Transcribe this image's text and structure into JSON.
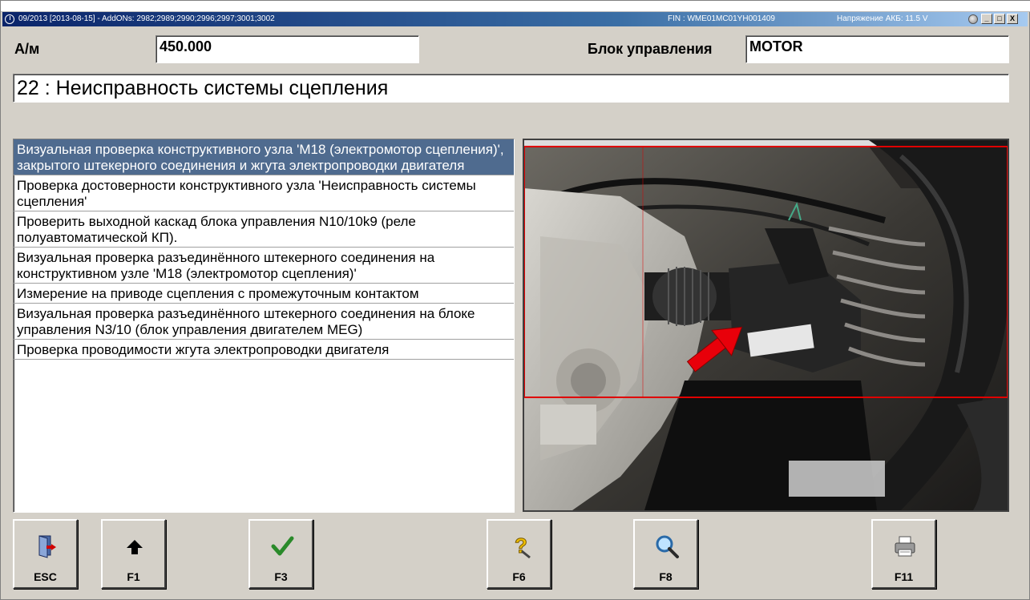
{
  "window": {
    "title": "09/2013 [2013-08-15] - AddONs: 2982;2989;2990;2996;2997;3001;3002",
    "fin": "FIN : WME01MC01YH001409",
    "voltage": "Напряжение АКБ: 11.5 V",
    "buttons": [
      "_",
      "□",
      "X"
    ]
  },
  "header": {
    "am_label": "А/м",
    "am_value": "450.000",
    "ecu_label": "Блок управления",
    "ecu_value": "MOTOR"
  },
  "fault": {
    "title": "22 : Неисправность системы сцепления"
  },
  "tests": [
    {
      "label": "Визуальная проверка конструктивного узла 'M18 (электромотор сцепления)', закрытого штекерного соединения и жгута электропроводки двигателя",
      "selected": true
    },
    {
      "label": "Проверка достоверности конструктивного узла 'Неисправность системы сцепления'",
      "selected": false
    },
    {
      "label": "Проверить выходной каскад блока управления N10/10k9 (реле полуавтоматической КП).",
      "selected": false
    },
    {
      "label": "Визуальная проверка разъединённого штекерного соединения на конструктивном узле 'M18 (электромотор сцепления)'",
      "selected": false
    },
    {
      "label": "Измерение на приводе сцепления с промежуточным контактом",
      "selected": false
    },
    {
      "label": "Визуальная проверка разъединённого штекерного соединения на блоке управления N3/10 (блок управления двигателем MEG)",
      "selected": false
    },
    {
      "label": "Проверка проводимости жгута электропроводки двигателя",
      "selected": false
    }
  ],
  "image": {
    "highlight_color": "#e00000",
    "arrow_color": "#e8000a"
  },
  "fkeys": [
    {
      "key": "ESC",
      "icon": "exit-door-icon"
    },
    {
      "key": "F1",
      "icon": "arrow-up-icon"
    },
    {
      "key": "F3",
      "icon": "checkmark-icon"
    },
    {
      "key": "F6",
      "icon": "help-question-icon"
    },
    {
      "key": "F8",
      "icon": "magnifier-icon"
    },
    {
      "key": "F11",
      "icon": "printer-icon"
    }
  ]
}
